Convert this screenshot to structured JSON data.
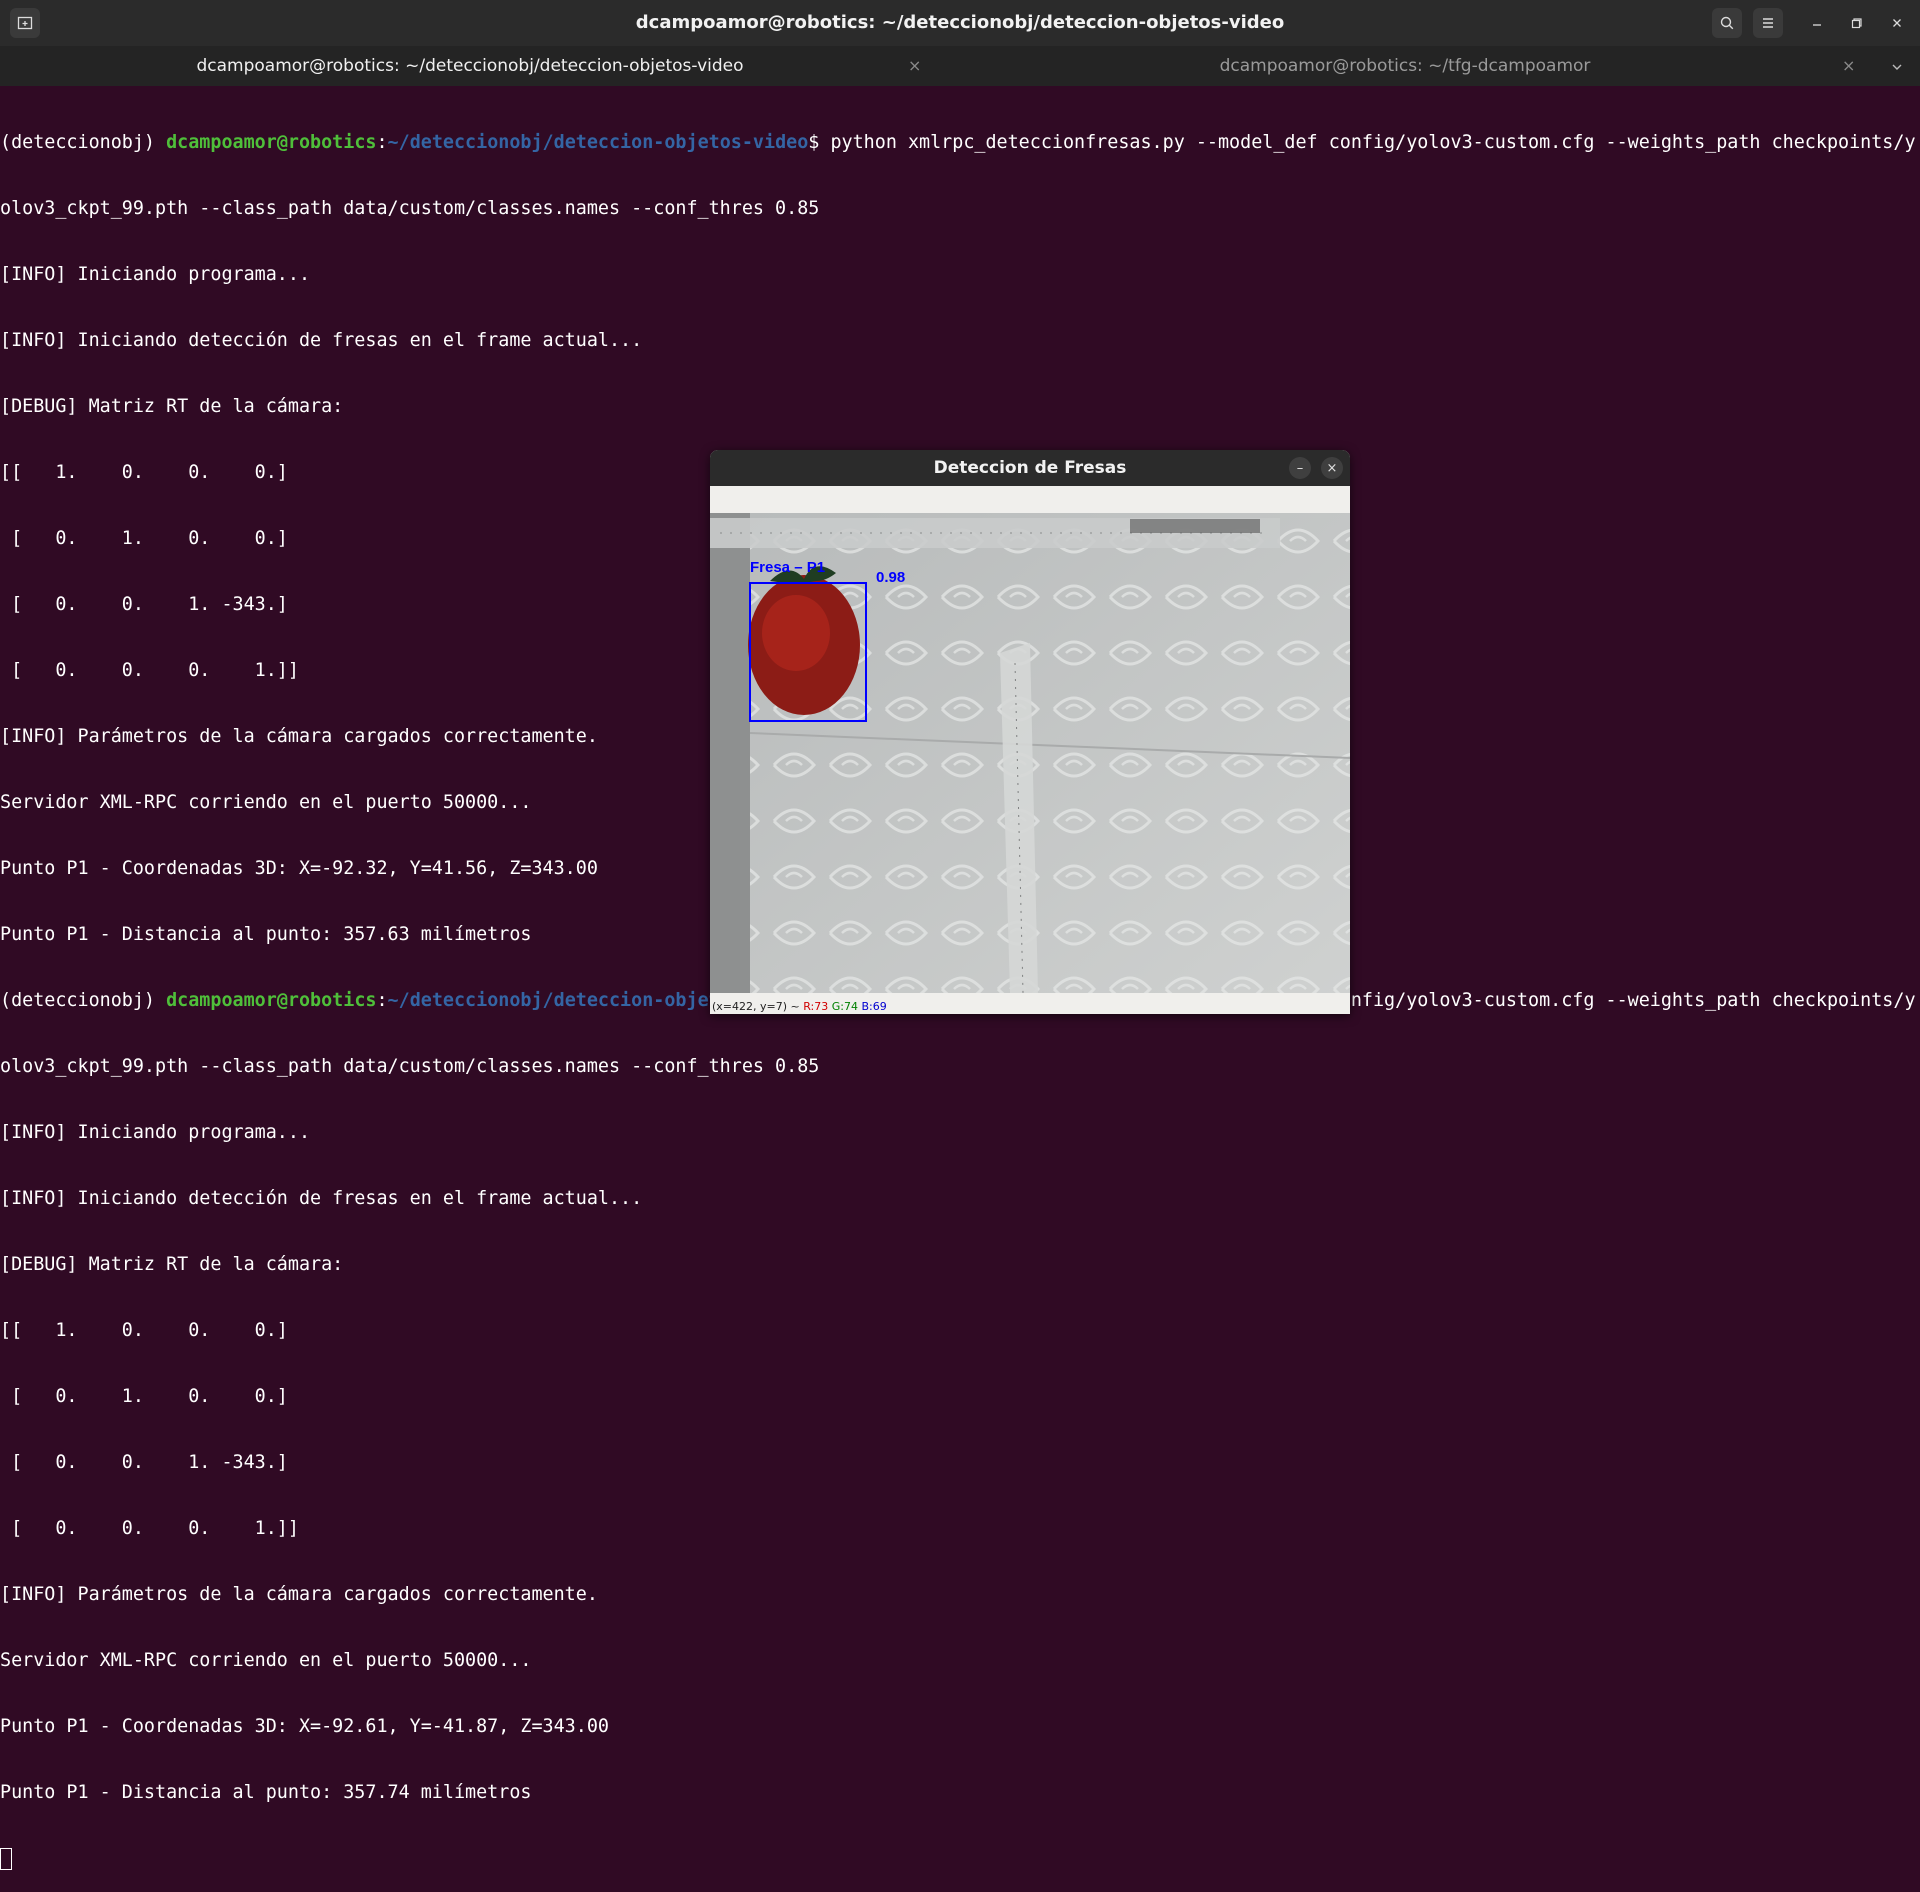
{
  "window": {
    "title": "dcampoamor@robotics: ~/deteccionobj/deteccion-objetos-video"
  },
  "tabs": [
    {
      "label": "dcampoamor@robotics: ~/deteccionobj/deteccion-objetos-video",
      "close": "×"
    },
    {
      "label": "dcampoamor@robotics: ~/tfg-dcampoamor",
      "close": "×"
    }
  ],
  "icons": {
    "new_tab": "new-tab-icon",
    "search": "search-icon",
    "menu": "hamburger-menu-icon",
    "minimize": "minimize-icon",
    "maximize": "maximize-icon",
    "close": "close-icon",
    "tabs_dropdown": "chevron-down-icon"
  },
  "prompt": {
    "env": "(deteccionobj) ",
    "user": "dcampoamor@robotics",
    "sep": ":",
    "path": "~/deteccionobj/deteccion-objetos-video",
    "dollar": "$ "
  },
  "terminal": {
    "command_1": "python xmlrpc_deteccionfresas.py --model_def config/yolov3-custom.cfg --weights_path checkpoints/y",
    "command_1_wrap": "olov3_ckpt_99.pth --class_path data/custom/classes.names --conf_thres 0.85",
    "run1": [
      "[INFO] Iniciando programa...",
      "[INFO] Iniciando detección de fresas en el frame actual...",
      "[DEBUG] Matriz RT de la cámara:",
      "[[   1.    0.    0.    0.]",
      " [   0.    1.    0.    0.]",
      " [   0.    0.    1. -343.]",
      " [   0.    0.    0.    1.]]",
      "[INFO] Parámetros de la cámara cargados correctamente.",
      "Servidor XML-RPC corriendo en el puerto 50000...",
      "Punto P1 - Coordenadas 3D: X=-92.32, Y=41.56, Z=343.00",
      "Punto P1 - Distancia al punto: 357.63 milímetros"
    ],
    "command_2": "python xmlrpc_deteccionfresas.py --model_def config/yolov3-custom.cfg --weights_path checkpoints/y",
    "command_2_wrap": "olov3_ckpt_99.pth --class_path data/custom/classes.names --conf_thres 0.85",
    "run2": [
      "[INFO] Iniciando programa...",
      "[INFO] Iniciando detección de fresas en el frame actual...",
      "[DEBUG] Matriz RT de la cámara:",
      "[[   1.    0.    0.    0.]",
      " [   0.    1.    0.    0.]",
      " [   0.    0.    1. -343.]",
      " [   0.    0.    0.    1.]]",
      "[INFO] Parámetros de la cámara cargados correctamente.",
      "Servidor XML-RPC corriendo en el puerto 50000...",
      "Punto P1 - Coordenadas 3D: X=-92.61, Y=-41.87, Z=343.00",
      "Punto P1 - Distancia al punto: 357.74 milímetros"
    ]
  },
  "opencv_window": {
    "title": "Deteccion de Fresas",
    "minimize": "–",
    "close": "×",
    "detection_label": "Fresa – P1",
    "confidence": "0.98",
    "status_coords": "(x=422, y=7) ~ ",
    "status_r": "R:73",
    "status_g": "G:74",
    "status_b": "B:69"
  },
  "colors": {
    "terminal_bg": "#300a24",
    "prompt_user": "#4fbf3a",
    "prompt_path": "#3465a4",
    "bbox": "#0000ff"
  }
}
